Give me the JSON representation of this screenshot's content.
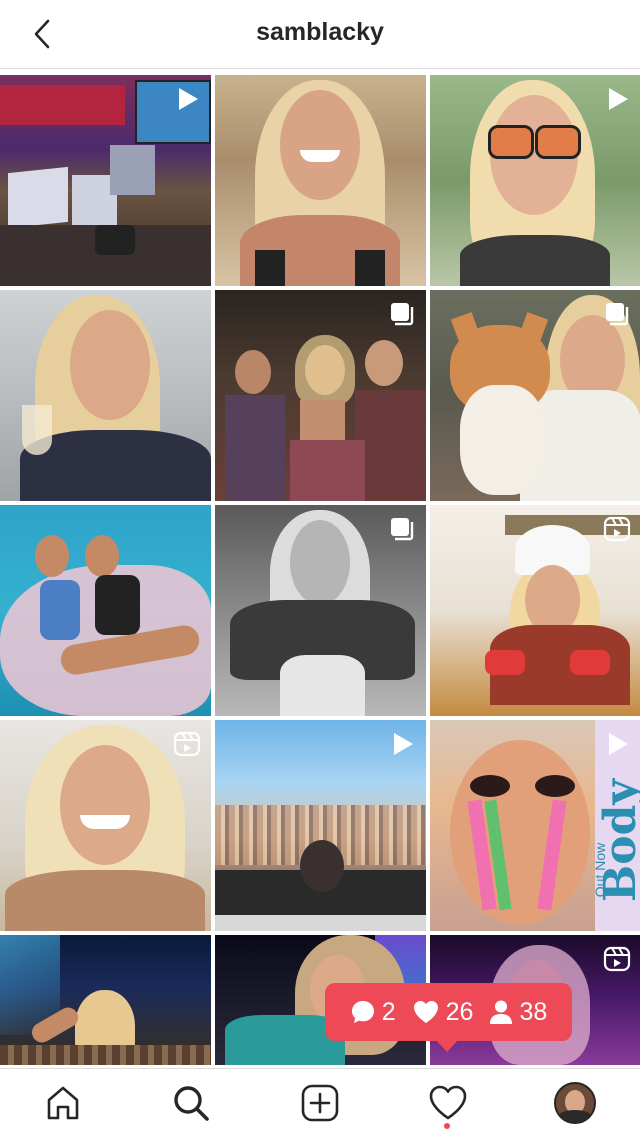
{
  "header": {
    "username": "samblacky"
  },
  "grid": {
    "posts": [
      {
        "badge": "reel-icon"
      },
      {
        "badge": "none"
      },
      {
        "badge": "reel-icon"
      },
      {
        "badge": "none"
      },
      {
        "badge": "carousel-icon"
      },
      {
        "badge": "carousel-icon"
      },
      {
        "badge": "none"
      },
      {
        "badge": "carousel-icon"
      },
      {
        "badge": "clips-icon"
      },
      {
        "badge": "clips-icon"
      },
      {
        "badge": "reel-icon"
      },
      {
        "badge": "reel-icon"
      },
      {
        "badge": "none"
      },
      {
        "badge": "none"
      },
      {
        "badge": "clips-icon"
      }
    ],
    "post_text": {
      "tile12_vertical": "Body",
      "tile12_small": "Out Now"
    }
  },
  "activity": {
    "comments": "2",
    "likes": "26",
    "follows": "38"
  },
  "tabbar": {
    "items": [
      "home-icon",
      "search-icon",
      "new-post-icon",
      "activity-icon",
      "profile-avatar"
    ]
  },
  "colors": {
    "accent": "#ed4956",
    "text": "#262626",
    "divider": "#dbdbdb"
  }
}
